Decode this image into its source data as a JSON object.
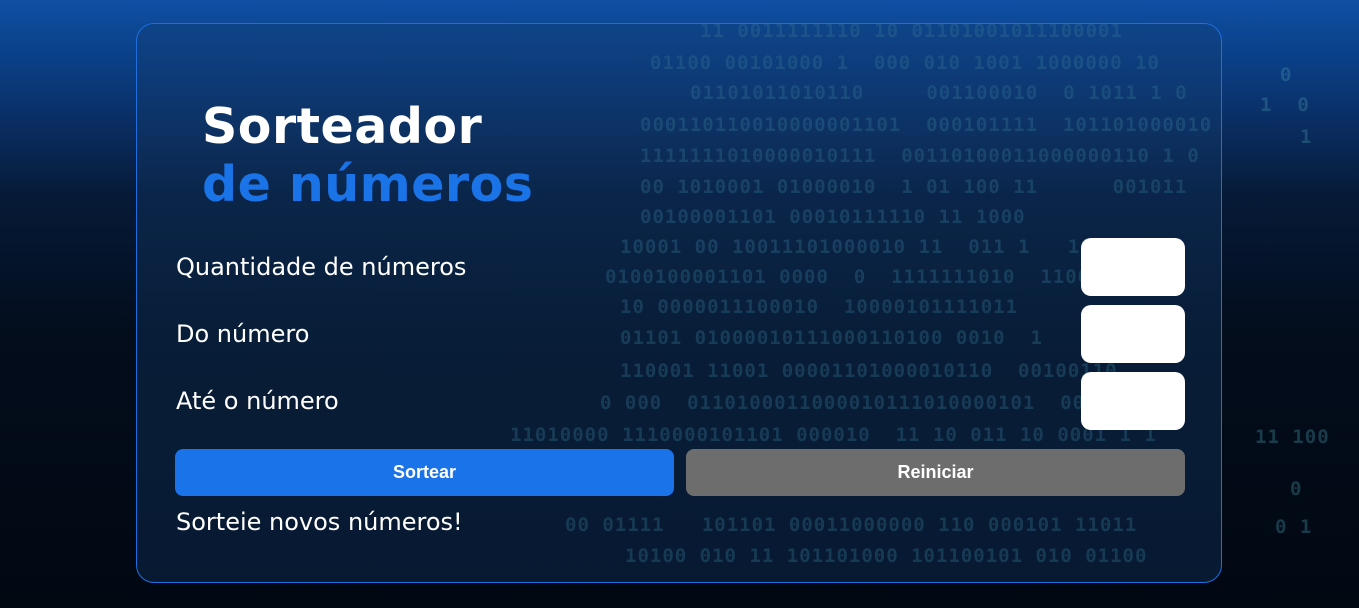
{
  "header": {
    "title_line1": "Sorteador",
    "title_line2": "de números"
  },
  "form": {
    "quantity_label": "Quantidade de números",
    "quantity_value": "",
    "from_label": "Do número",
    "from_value": "",
    "to_label": "Até o número",
    "to_value": ""
  },
  "actions": {
    "draw_label": "Sortear",
    "reset_label": "Reiniciar"
  },
  "status": {
    "message": "Sorteie novos números!"
  },
  "colors": {
    "accent": "#1a73e8",
    "reset_button": "#6d6d6d",
    "card_border": "#1d6fe0"
  }
}
